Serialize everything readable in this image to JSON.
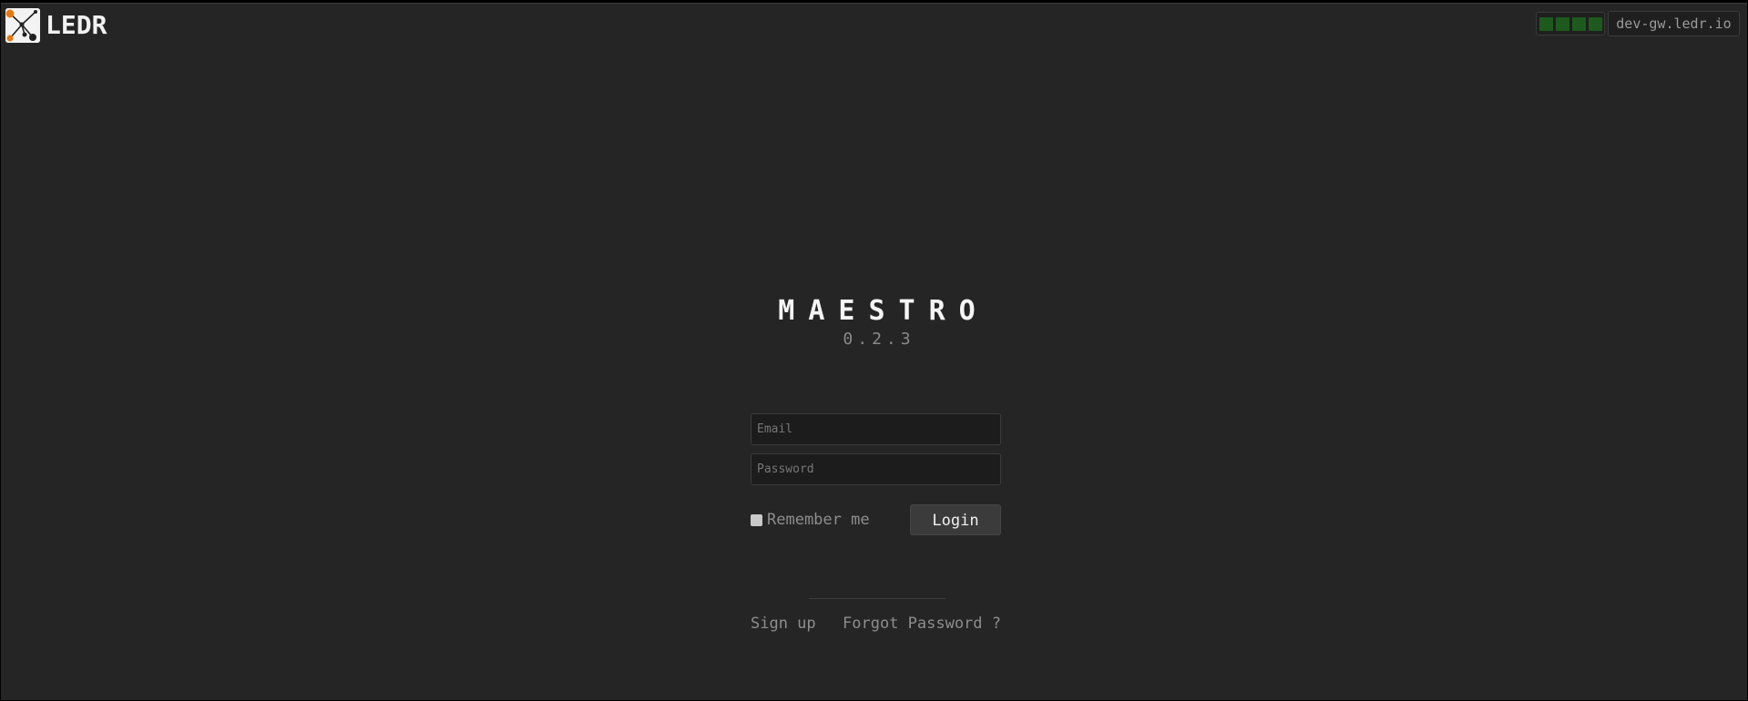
{
  "header": {
    "brand_name": "LEDR",
    "logo_icon": "network-nodes-icon",
    "status_bars": 4,
    "status_color": "#1e5a1e",
    "host": "dev-gw.ledr.io"
  },
  "app": {
    "title": "MAESTRO",
    "version": "0.2.3"
  },
  "form": {
    "email_placeholder": "Email",
    "password_placeholder": "Password",
    "remember_label": "Remember me",
    "login_label": "Login"
  },
  "links": {
    "signup_label": "Sign up",
    "forgot_label": "Forgot Password ?"
  },
  "colors": {
    "background": "#252525",
    "accent": "#e07b1a"
  }
}
